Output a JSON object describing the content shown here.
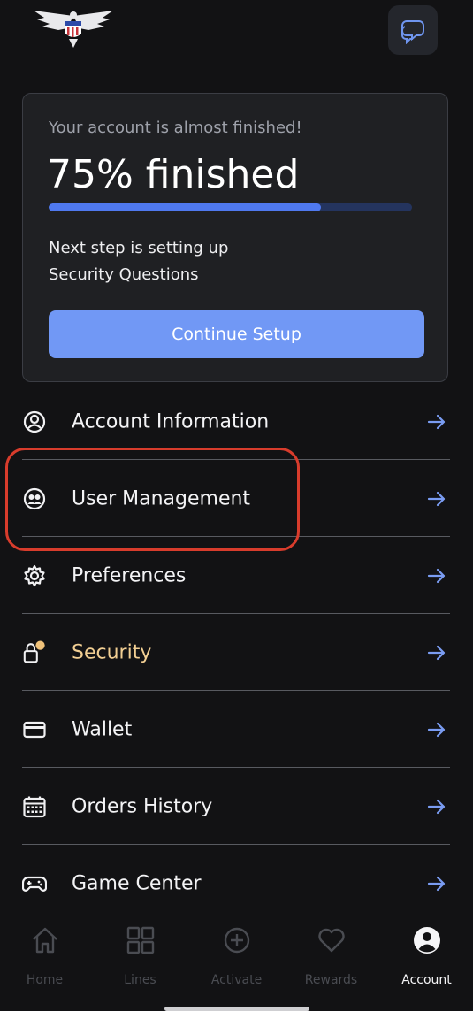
{
  "progress_card": {
    "subtitle": "Your account is almost finished!",
    "title": "75% finished",
    "progress_fraction": 0.75,
    "next_step_line1": "Next step is setting up",
    "next_step_line2": "Security Questions",
    "continue_label": "Continue Setup"
  },
  "menu": {
    "items": [
      {
        "label": "Account Information",
        "icon": "user-circle-icon"
      },
      {
        "label": "User Management",
        "icon": "users-circle-icon"
      },
      {
        "label": "Preferences",
        "icon": "gear-icon"
      },
      {
        "label": "Security",
        "icon": "lock-icon",
        "badge_color": "#f0c27a",
        "label_color": "#f2cf93"
      },
      {
        "label": "Wallet",
        "icon": "card-icon"
      },
      {
        "label": "Orders History",
        "icon": "calendar-icon"
      },
      {
        "label": "Game Center",
        "icon": "gamepad-icon"
      }
    ]
  },
  "bottom_nav": {
    "items": [
      {
        "label": "Home",
        "icon": "home-icon",
        "active": false
      },
      {
        "label": "Lines",
        "icon": "grid-icon",
        "active": false
      },
      {
        "label": "Activate",
        "icon": "plus-circle-icon",
        "active": false
      },
      {
        "label": "Rewards",
        "icon": "heart-icon",
        "active": false
      },
      {
        "label": "Account",
        "icon": "account-icon",
        "active": true
      }
    ]
  },
  "colors": {
    "accent": "#7198f5",
    "progress_fill": "#4f79ef",
    "arrow": "#7a9cf2",
    "highlight": "#d83c2c"
  }
}
